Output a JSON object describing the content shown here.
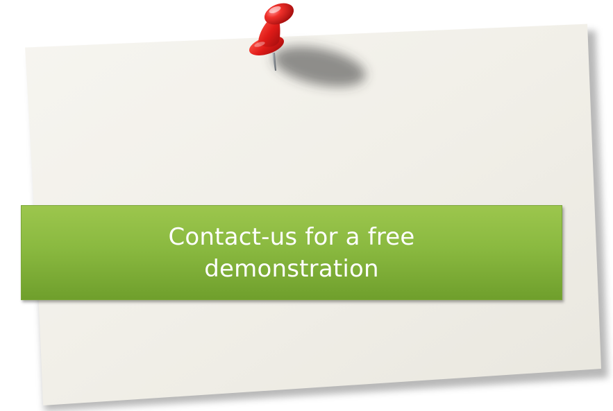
{
  "cta": {
    "label": "Contact-us for a free demonstration"
  },
  "icons": {
    "pin": "push-pin-icon"
  },
  "colors": {
    "note": "#f3f1ea",
    "banner_top": "#9cc64d",
    "banner_bottom": "#6f9f2c",
    "pin_red": "#e21c1c"
  }
}
